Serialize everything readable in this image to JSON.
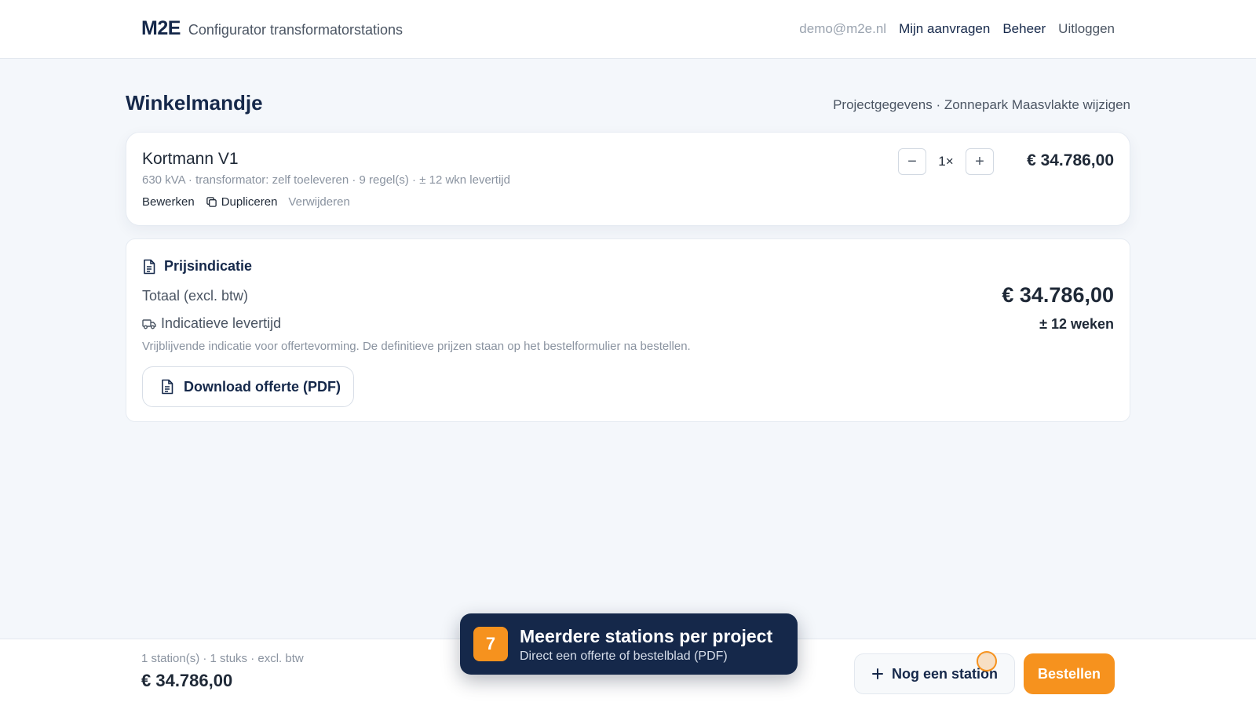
{
  "header": {
    "logo": "M2E",
    "subtitle": "Configurator transformatorstations",
    "email": "demo@m2e.nl",
    "nav": {
      "requests": "Mijn aanvragen",
      "admin": "Beheer",
      "logout": "Uitloggen"
    }
  },
  "page": {
    "title": "Winkelmandje",
    "project_link": "Projectgegevens · Zonnepark Maasvlakte wijzigen"
  },
  "cart_item": {
    "name": "Kortmann V1",
    "meta": "630 kVA · transformator: zelf toeleveren · 9 regel(s) · ± 12 wkn levertijd",
    "actions": {
      "edit": "Bewerken",
      "duplicate": "Dupliceren",
      "remove": "Verwijderen"
    },
    "qty_minus": "−",
    "qty": "1×",
    "qty_plus": "+",
    "price": "€ 34.786,00"
  },
  "price_card": {
    "title": "Prijsindicatie",
    "total_label": "Totaal (excl. btw)",
    "total": "€ 34.786,00",
    "lead_label": "Indicatieve levertijd",
    "lead": "± 12 weken",
    "note": "Vrijblijvende indicatie voor offertevorming. De definitieve prijzen staan op het bestelformulier na bestellen.",
    "download": "Download offerte (PDF)"
  },
  "bottom_bar": {
    "meta": "1 station(s) · 1 stuks · excl. btw",
    "total": "€ 34.786,00",
    "add_station": "Nog een station",
    "order": "Bestellen"
  },
  "toast": {
    "step": "7",
    "title": "Meerdere stations per project",
    "subtitle": "Direct een offerte of bestelblad (PDF)"
  },
  "colors": {
    "brand": "#15284a",
    "accent": "#f6921e",
    "background": "#f4f7fb"
  },
  "icons": {
    "duplicate": "copy-icon",
    "document": "document-icon",
    "truck": "truck-icon",
    "plus": "plus-icon"
  }
}
